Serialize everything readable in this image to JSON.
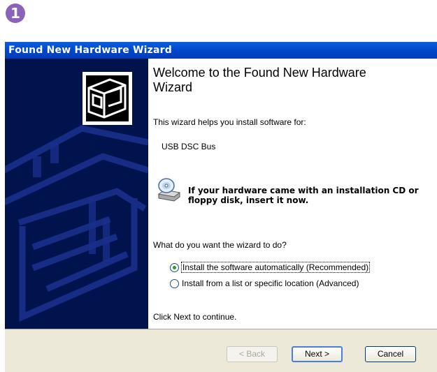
{
  "step_badge": "1",
  "window": {
    "title": "Found New Hardware Wizard"
  },
  "wizard": {
    "heading": "Welcome to the Found New Hardware Wizard",
    "intro": "This wizard helps you install software for:",
    "device_name": "USB DSC Bus",
    "cd_note": "If your hardware came with an installation CD or floppy disk, insert it now.",
    "question": "What do you want the wizard to do?",
    "options": [
      {
        "label": "Install the software automatically (Recommended)",
        "selected": true
      },
      {
        "label": "Install from a list or specific location (Advanced)",
        "selected": false
      }
    ],
    "continue_text": "Click Next to continue."
  },
  "buttons": {
    "back": "< Back",
    "next": "Next >",
    "cancel": "Cancel"
  },
  "colors": {
    "titlebar": "#0046c8",
    "left_pane": "#00134d",
    "bottom_bar": "#ece9d8",
    "badge": "#8a63b8"
  },
  "icons": [
    "hardware-card-icon",
    "cd-disk-icon",
    "radio-selected",
    "radio-unselected"
  ]
}
